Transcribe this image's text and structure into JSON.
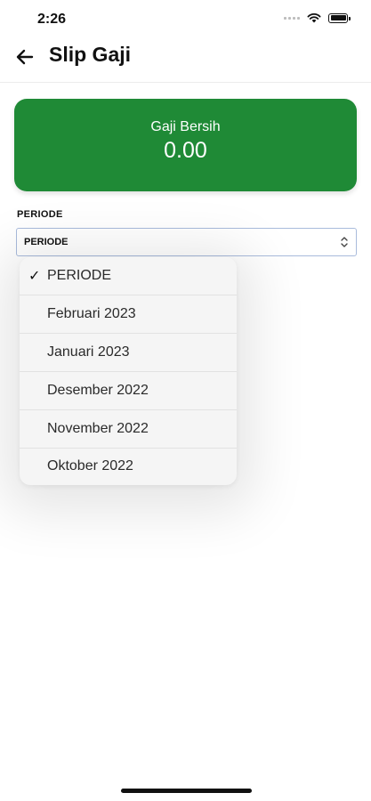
{
  "status_bar": {
    "time": "2:26"
  },
  "app_bar": {
    "title": "Slip Gaji",
    "back_icon": "arrow-left-icon"
  },
  "summary_card": {
    "label": "Gaji Bersih",
    "value": "0.00",
    "color": "#1f8a36"
  },
  "period_field": {
    "label": "PERIODE",
    "selected": "PERIODE",
    "options": [
      {
        "label": "PERIODE",
        "checked": true
      },
      {
        "label": "Februari 2023",
        "checked": false
      },
      {
        "label": "Januari 2023",
        "checked": false
      },
      {
        "label": "Desember 2022",
        "checked": false
      },
      {
        "label": "November 2022",
        "checked": false
      },
      {
        "label": "Oktober 2022",
        "checked": false
      }
    ],
    "check_mark": "✓"
  }
}
